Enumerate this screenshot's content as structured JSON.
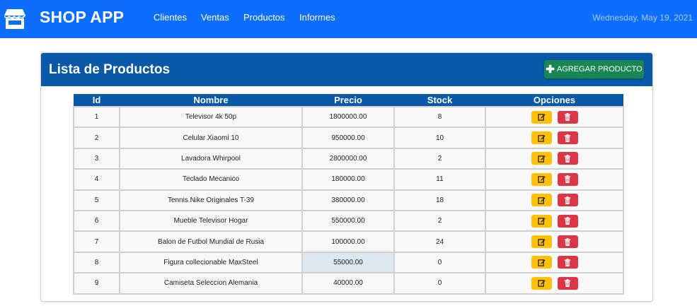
{
  "navbar": {
    "brand": "SHOP APP",
    "links": [
      "Clientes",
      "Ventas",
      "Productos",
      "Informes"
    ],
    "date": "Wednesday, May 19, 2021"
  },
  "card": {
    "title": "Lista de Productos",
    "add_button": "AGREGAR PRODUCTO"
  },
  "table": {
    "headers": [
      "Id",
      "Nombre",
      "Precio",
      "Stock",
      "Opciones"
    ],
    "rows": [
      {
        "id": "1",
        "nombre": "Televisor 4k 50p",
        "precio": "1800000.00",
        "stock": "8"
      },
      {
        "id": "2",
        "nombre": "Celular Xiaomi 10",
        "precio": "950000.00",
        "stock": "10"
      },
      {
        "id": "3",
        "nombre": "Lavadora Whirpool",
        "precio": "2800000.00",
        "stock": "2"
      },
      {
        "id": "4",
        "nombre": "Teclado Mecanico",
        "precio": "180000.00",
        "stock": "11"
      },
      {
        "id": "5",
        "nombre": "Tennis Nike Originales T-39",
        "precio": "380000.00",
        "stock": "18"
      },
      {
        "id": "6",
        "nombre": "Mueble Televisor Hogar",
        "precio": "550000.00",
        "stock": "2"
      },
      {
        "id": "7",
        "nombre": "Balon de Futbol Mundial de Rusia",
        "precio": "100000.00",
        "stock": "24"
      },
      {
        "id": "8",
        "nombre": "Figura collecionable MaxSteel",
        "precio": "55000.00",
        "stock": "0"
      },
      {
        "id": "9",
        "nombre": "Camiseta Seleccion Alemania",
        "precio": "40000.00",
        "stock": "0"
      }
    ]
  },
  "icons": {
    "brand": "store-icon",
    "add": "plus-icon",
    "edit": "edit-icon",
    "delete": "trash-icon"
  },
  "colors": {
    "navbar": "#0d6efd",
    "header": "#0a58a8",
    "add": "#198754",
    "edit": "#ffc107",
    "delete": "#dc3545"
  }
}
